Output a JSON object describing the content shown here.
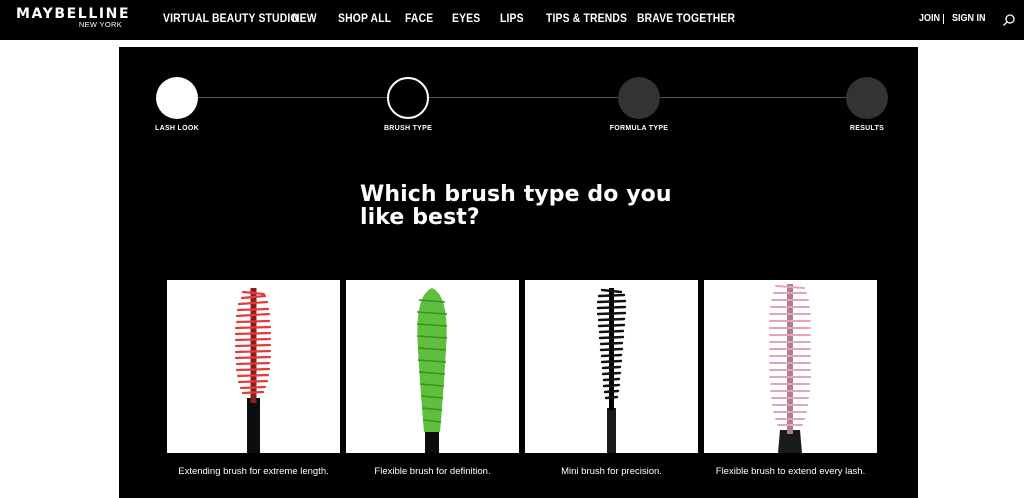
{
  "brand": {
    "name": "MAYBELLINE",
    "subname": "NEW YORK"
  },
  "nav": [
    {
      "label": "VIRTUAL BEAUTY STUDIO"
    },
    {
      "label": "NEW"
    },
    {
      "label": "SHOP ALL"
    },
    {
      "label": "FACE"
    },
    {
      "label": "EYES"
    },
    {
      "label": "LIPS"
    },
    {
      "label": "TIPS & TRENDS"
    },
    {
      "label": "BRAVE TOGETHER"
    }
  ],
  "account": {
    "join": "JOIN",
    "signin": "SIGN IN"
  },
  "icons": {
    "search": "search-icon"
  },
  "steps": [
    {
      "label": "LASH LOOK",
      "state": "done"
    },
    {
      "label": "BRUSH TYPE",
      "state": "current"
    },
    {
      "label": "FORMULA TYPE",
      "state": "todo"
    },
    {
      "label": "RESULTS",
      "state": "todo"
    }
  ],
  "question": "Which brush type do you like best?",
  "options": [
    {
      "caption": "Extending brush for extreme length.",
      "brush_color": "#e53a3a"
    },
    {
      "caption": "Flexible brush for definition.",
      "brush_color": "#5fbf3c"
    },
    {
      "caption": "Mini brush for precision.",
      "brush_color": "#111111"
    },
    {
      "caption": "Flexible brush to extend every lash.",
      "brush_color": "#e3a4bb"
    }
  ]
}
